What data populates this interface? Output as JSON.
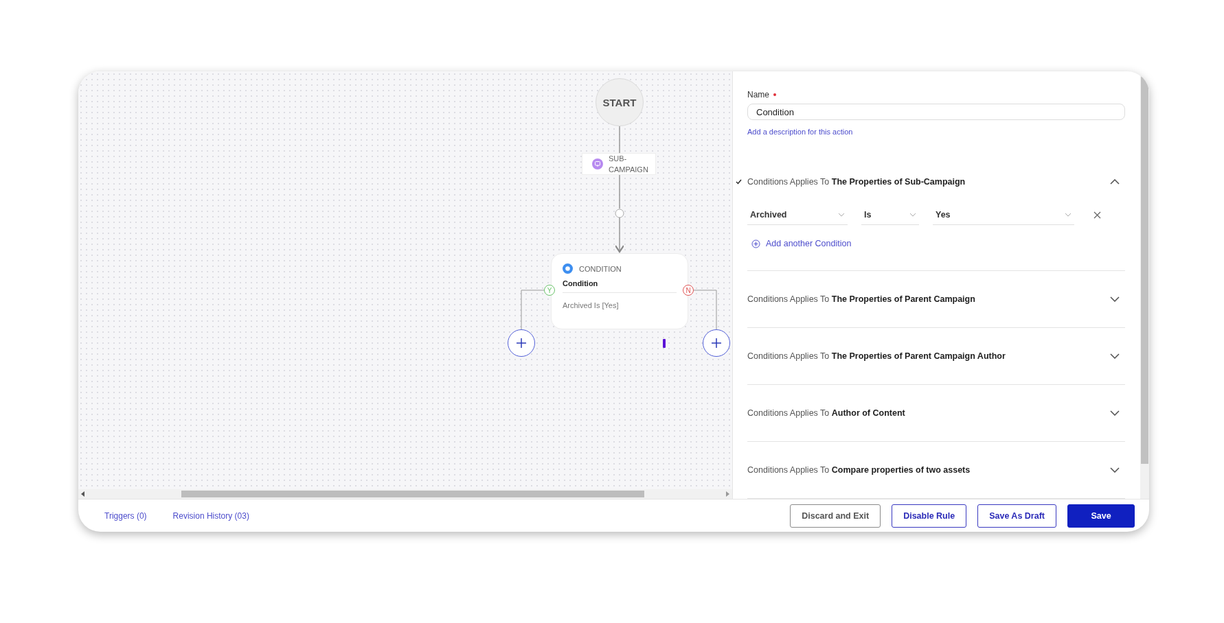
{
  "canvas": {
    "start_node": {
      "label": "START"
    },
    "sub_campaign_node": {
      "label": "SUB-CAMPAIGN"
    },
    "condition_node": {
      "type_label": "CONDITION",
      "title": "Condition",
      "summary": "Archived Is [Yes]",
      "yes_label": "Y",
      "no_label": "N"
    }
  },
  "panel": {
    "name_label": "Name",
    "name_required": true,
    "name_value": "Condition",
    "description_link": "Add a description for this action",
    "sections": [
      {
        "title": "Conditions Applies To **The Properties of Sub-Campaign**",
        "checked": true,
        "expanded": true,
        "conditions": [
          {
            "field": "Archived",
            "operator": "Is",
            "value": "Yes"
          }
        ],
        "add_label": "Add another Condition"
      },
      {
        "title": "Conditions Applies To **The Properties of Parent Campaign**",
        "checked": false,
        "expanded": false
      },
      {
        "title": "Conditions Applies To **The Properties of Parent Campaign Author**",
        "checked": false,
        "expanded": false
      },
      {
        "title": "Conditions Applies To **Author of Content**",
        "checked": false,
        "expanded": false
      },
      {
        "title": "Conditions Applies To **Compare properties of two assets**",
        "checked": false,
        "expanded": false
      }
    ]
  },
  "footer": {
    "links": [
      "Triggers (0)",
      "Revision History (03)"
    ],
    "buttons": [
      {
        "label": "Discard and Exit",
        "kind": "neutral"
      },
      {
        "label": "Disable Rule",
        "kind": "outline"
      },
      {
        "label": "Save As Draft",
        "kind": "outline"
      },
      {
        "label": "Save",
        "kind": "primary"
      }
    ]
  }
}
